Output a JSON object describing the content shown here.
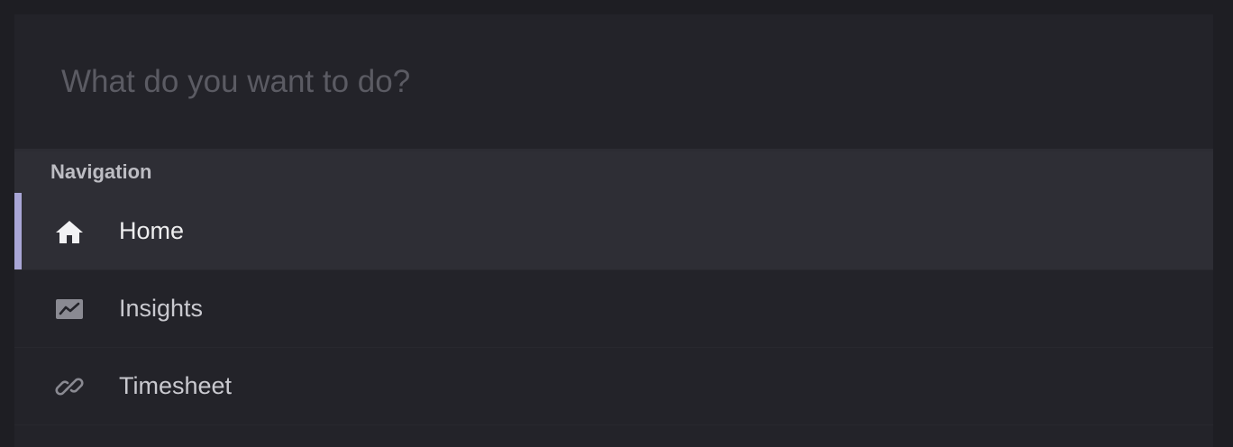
{
  "search": {
    "placeholder": "What do you want to do?",
    "value": ""
  },
  "navigation": {
    "header": "Navigation",
    "items": [
      {
        "label": "Home",
        "icon": "home-icon",
        "selected": true
      },
      {
        "label": "Insights",
        "icon": "chart-icon",
        "selected": false
      },
      {
        "label": "Timesheet",
        "icon": "link-icon",
        "selected": false
      }
    ]
  },
  "colors": {
    "accent": "#a9a6d6",
    "panel": "#232329",
    "selected_row": "#2e2e35"
  }
}
